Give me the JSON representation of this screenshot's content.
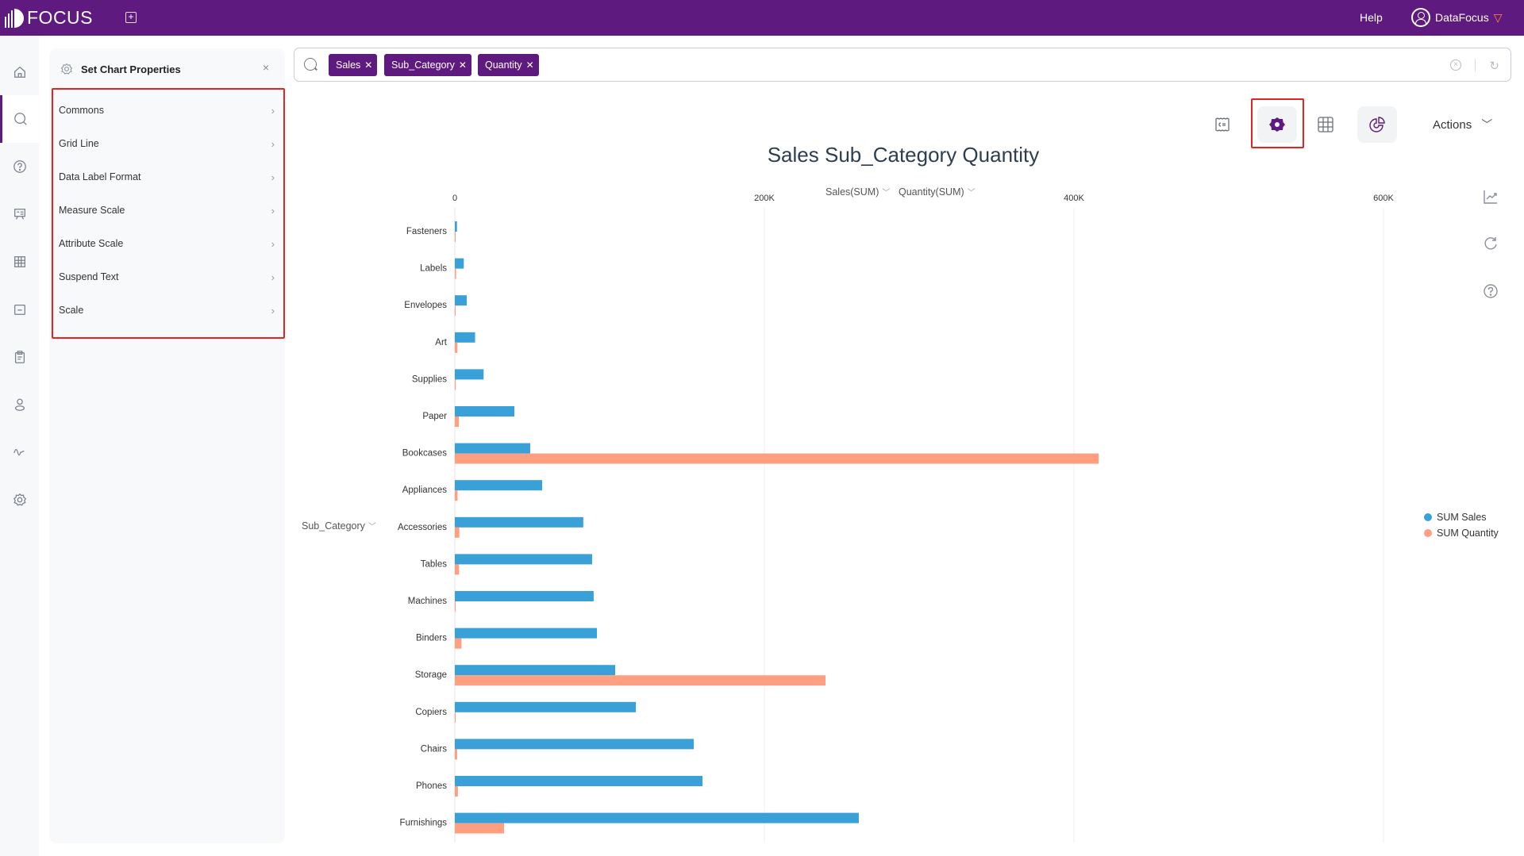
{
  "app": {
    "logo_text": "FOCUS",
    "help_label": "Help",
    "user_name": "DataFocus",
    "brand_color": "#5e1a7e"
  },
  "leftnav": {
    "items": [
      {
        "icon": "home-icon"
      },
      {
        "icon": "search-icon",
        "active": true
      },
      {
        "icon": "question-icon"
      },
      {
        "icon": "presentation-icon"
      },
      {
        "icon": "table-icon"
      },
      {
        "icon": "folder-icon"
      },
      {
        "icon": "clipboard-icon"
      },
      {
        "icon": "user-icon"
      },
      {
        "icon": "pulse-icon"
      },
      {
        "icon": "settings-icon"
      }
    ]
  },
  "properties_panel": {
    "title": "Set Chart Properties",
    "close_label": "×",
    "items": [
      {
        "label": "Commons"
      },
      {
        "label": "Grid Line"
      },
      {
        "label": "Data Label Format"
      },
      {
        "label": "Measure Scale"
      },
      {
        "label": "Attribute Scale"
      },
      {
        "label": "Suspend Text"
      },
      {
        "label": "Scale"
      }
    ]
  },
  "search": {
    "tags": [
      {
        "label": "Sales"
      },
      {
        "label": "Sub_Category"
      },
      {
        "label": "Quantity"
      }
    ],
    "remove_glyph": "✕"
  },
  "toolbar": {
    "actions_label": "Actions",
    "tools": [
      "data-summary-icon",
      "chart-settings-icon",
      "table-view-icon",
      "chart-type-icon"
    ]
  },
  "chart_controls": {
    "measure_selects": [
      "Sales(SUM)",
      "Quantity(SUM)"
    ],
    "attribute_select": "Sub_Category"
  },
  "chart_data": {
    "type": "bar",
    "orientation": "horizontal",
    "title": "Sales Sub_Category Quantity",
    "xlabel": "",
    "ylabel": "Sub_Category",
    "xlim": [
      0,
      650000
    ],
    "x_ticks": [
      0,
      200000,
      400000,
      600000
    ],
    "x_tick_labels": [
      "0",
      "200K",
      "400K",
      "600K"
    ],
    "grid": true,
    "legend_position": "right",
    "categories": [
      "Fasteners",
      "Labels",
      "Envelopes",
      "Art",
      "Supplies",
      "Paper",
      "Bookcases",
      "Appliances",
      "Accessories",
      "Tables",
      "Machines",
      "Binders",
      "Storage",
      "Copiers",
      "Chairs",
      "Phones",
      "Furnishings"
    ],
    "series": [
      {
        "name": "SUM Sales",
        "color": "#3aa0d8",
        "values": [
          1400,
          5800,
          7700,
          13100,
          18600,
          38500,
          48700,
          56400,
          83000,
          88700,
          89700,
          91800,
          103600,
          117000,
          154400,
          160000,
          261000
        ]
      },
      {
        "name": "SUM Quantity",
        "color": "#ff9f80",
        "values": [
          300,
          800,
          500,
          1700,
          600,
          2600,
          416000,
          1800,
          2900,
          2700,
          400,
          4300,
          239500,
          100,
          1500,
          2000,
          31800
        ]
      }
    ]
  }
}
